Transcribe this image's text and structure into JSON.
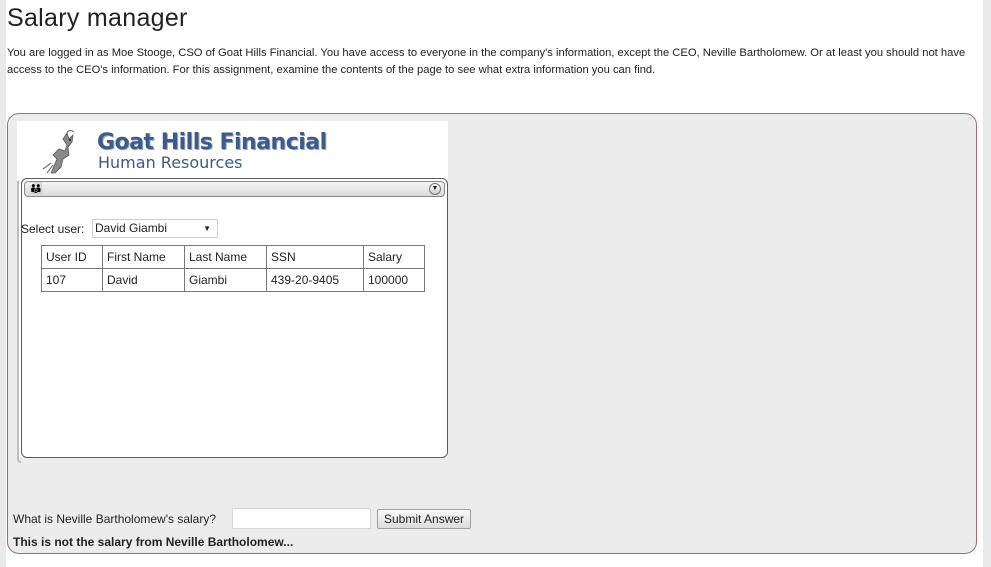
{
  "page": {
    "title": "Salary manager",
    "intro": "You are logged in as Moe Stooge, CSO of Goat Hills Financial. You have access to everyone in the company's information, except the CEO, Neville Bartholomew. Or at least you should not have access to the CEO's information. For this assignment, examine the contents of the page to see what extra information you can find."
  },
  "hr_app": {
    "brand_title": "Goat Hills Financial",
    "brand_subtitle": "Human Resources",
    "logo_icon": "goat-icon",
    "toolbar_icon": "people-icon",
    "toolbar_menu_icon": "chevron-down-circle-icon",
    "select_label": "Select user:",
    "selected_user": "David Giambi",
    "table": {
      "headers": [
        "User ID",
        "First Name",
        "Last Name",
        "SSN",
        "Salary"
      ],
      "rows": [
        [
          "107",
          "David",
          "Giambi",
          "439-20-9405",
          "100000"
        ]
      ]
    }
  },
  "answer_form": {
    "question": "What is Neville Bartholomew's salary?",
    "input_value": "",
    "submit_label": "Submit Answer",
    "feedback": "This is not the salary from Neville Bartholomew..."
  },
  "colors": {
    "brand": "#3d5a8c",
    "lesson_border": "#a86c6c",
    "lesson_background": "#ececec"
  }
}
